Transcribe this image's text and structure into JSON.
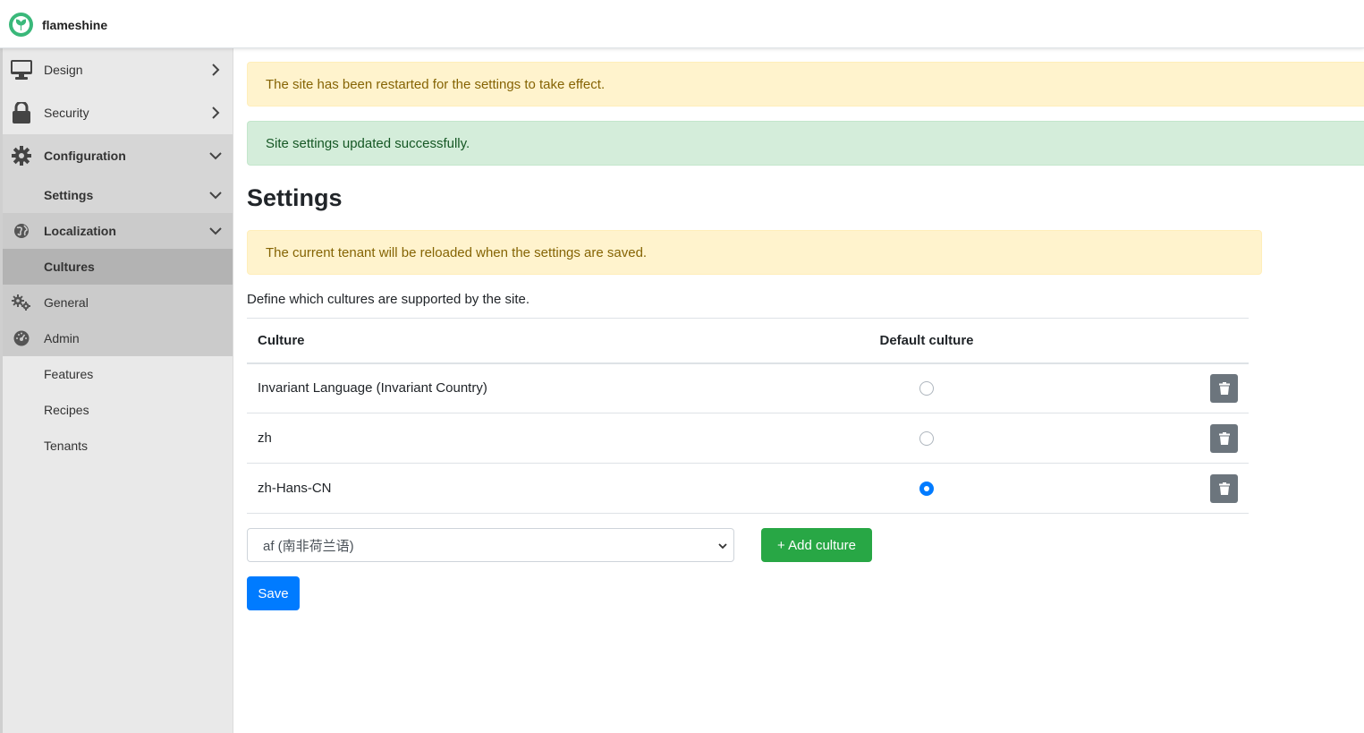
{
  "brand": {
    "name": "flameshine",
    "logo_icon": "leaf-logo-icon"
  },
  "sidebar": {
    "items": [
      {
        "label": "Design",
        "icon": "monitor-icon"
      },
      {
        "label": "Security",
        "icon": "lock-icon"
      },
      {
        "label": "Configuration",
        "icon": "gear-icon"
      },
      {
        "label": "Settings"
      },
      {
        "label": "Localization",
        "icon": "globe-icon"
      },
      {
        "label": "Cultures"
      },
      {
        "label": "General",
        "icon": "gears-icon"
      },
      {
        "label": "Admin",
        "icon": "dashboard-icon"
      },
      {
        "label": "Features"
      },
      {
        "label": "Recipes"
      },
      {
        "label": "Tenants"
      }
    ]
  },
  "alerts": {
    "restart": "The site has been restarted for the settings to take effect.",
    "success": "Site settings updated successfully.",
    "reload": "The current tenant will be reloaded when the settings are saved."
  },
  "page": {
    "title": "Settings",
    "description": "Define which cultures are supported by the site."
  },
  "table": {
    "headers": {
      "culture": "Culture",
      "default": "Default culture"
    },
    "rows": [
      {
        "culture": "Invariant Language (Invariant Country)",
        "is_default": false
      },
      {
        "culture": "zh",
        "is_default": false
      },
      {
        "culture": "zh-Hans-CN",
        "is_default": true
      }
    ]
  },
  "form": {
    "culture_select_value": "af (南非荷兰语)",
    "add_button": "+ Add culture",
    "save_button": "Save"
  },
  "colors": {
    "warning_bg": "#fff3cd",
    "success_bg": "#d4edda",
    "primary": "#007bff",
    "success": "#28a745",
    "secondary": "#6c757d"
  }
}
